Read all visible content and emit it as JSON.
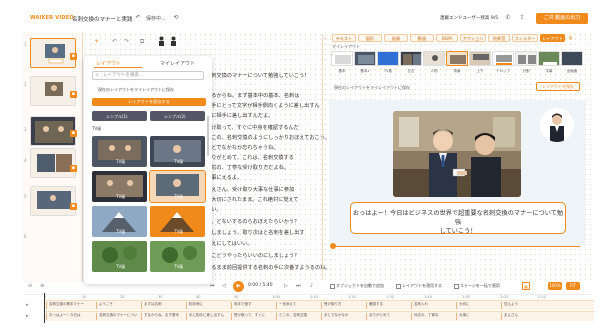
{
  "app": {
    "logo": "WAIKER VIDEO",
    "project_title": "名刺交換のマナーと実践",
    "save_state": "保存中...",
    "credits": "連載エンドユーザー残高 9/5",
    "export_label": "ご共 動画の出力"
  },
  "rail": {
    "slide_numbers": [
      "1",
      "2",
      "3",
      "4",
      "5",
      "6"
    ]
  },
  "script": {
    "lines": [
      "名刺交換のマナーについて勉強していこう！",
      "するからね。まず基本中の基本、名刺は",
      "相手にとって文字が相手側向くように差し出すん",
      "手に相手に差し出すんだよ。",
      "受け取って、すぐに中身を確認するんだ",
      "とこの、名刺交換のようにしっかりおぼえておこう。",
      "あとでなかなか忘れちゃうね。",
      "ありがとめて、これは、名刺交換する",
      "対応の、丁寧な受け取り方だよね。",
      "大事にえるよ。",
      "まえさん、受け取り大事な仕事に参加",
      "を大切にされたまま。これ絶対に覚えて",
      "さい。",
      "大、どないするのらおぼえたらいかう？",
      "大しましょう、取り次はと名刺を差し出す",
      "まえにしてはいい。",
      "とこどうやったらいいのにしましょう？",
      "するまま前回提供する名刺の手に次番すようるのね。"
    ]
  },
  "popup": {
    "tab_layout": "レイアウト",
    "tab_my_layout": "マイレイアウト",
    "search_placeholder": "レイアウトを検索...",
    "note": "現在のレイアウトをマイレイアウトに保存",
    "apply_label": "レイアウトを保存する",
    "section_label": "TV風",
    "thumb_labels": [
      "TV風",
      "TV風",
      "TV風",
      "TV風",
      "TV風",
      "TV風",
      "TV風",
      "TV風",
      "TV風",
      "TV風"
    ],
    "top_labels": [
      "シンプル(1)",
      "シンプル(2)"
    ]
  },
  "panel": {
    "tabs": [
      "テキスト",
      "図形",
      "画像",
      "動画",
      "BGM",
      "アクション",
      "効果音",
      "フィルター",
      "レイアウト"
    ],
    "my_layout_label": "マイレイアウト",
    "layout_names": [
      "基本",
      "基本2",
      "TV風",
      "左右",
      "人物",
      "背景",
      "上下",
      "テロップ",
      "分割",
      "字幕",
      "全画面",
      "右寄せ"
    ],
    "bar_note": "現在のレイアウトをマイレイアウトに保存",
    "bar_button": "レイアウトを保存"
  },
  "preview": {
    "caption_line1": "おっはよー！今日はビジネスの世界で超重要な名刺交換のマナーについて勉強",
    "caption_line2": "していこう！"
  },
  "controls": {
    "timecode": "0:00 / 5:40",
    "chk_auto_add": "オブジェクトを自動で追加",
    "chk_layout": "レイアウトを適用する",
    "chk_stage": "ステージを一括で適用",
    "btn_zoom": "100%",
    "btn_fit": "FIT"
  },
  "timeline": {
    "ticks": [
      "0",
      "10",
      "20",
      "30",
      "40",
      "50",
      "1:00",
      "1:10",
      "1:20",
      "1:30",
      "1:40",
      "1:50",
      "2:00",
      "2:10"
    ],
    "track1": [
      "名刺交換の基本マナー",
      "ようこそ",
      "まずは名刺",
      "相手側に",
      "両手で渡す",
      "一言添えて",
      "受け取り方",
      "確認する",
      "名刺入れ",
      "大切に",
      "覚えよう"
    ],
    "track2": [
      "おっはよー！今日は",
      "名刺交換のマナーについ",
      "するからね。まず基本",
      "手に相手に差し出すん",
      "受け取って、すぐに",
      "とこの、名刺交換",
      "あとでなかなか",
      "ありがとめて",
      "対応の、丁寧な",
      "大事に",
      "まえさん"
    ]
  },
  "colors": {
    "accent": "#f08a1a"
  }
}
